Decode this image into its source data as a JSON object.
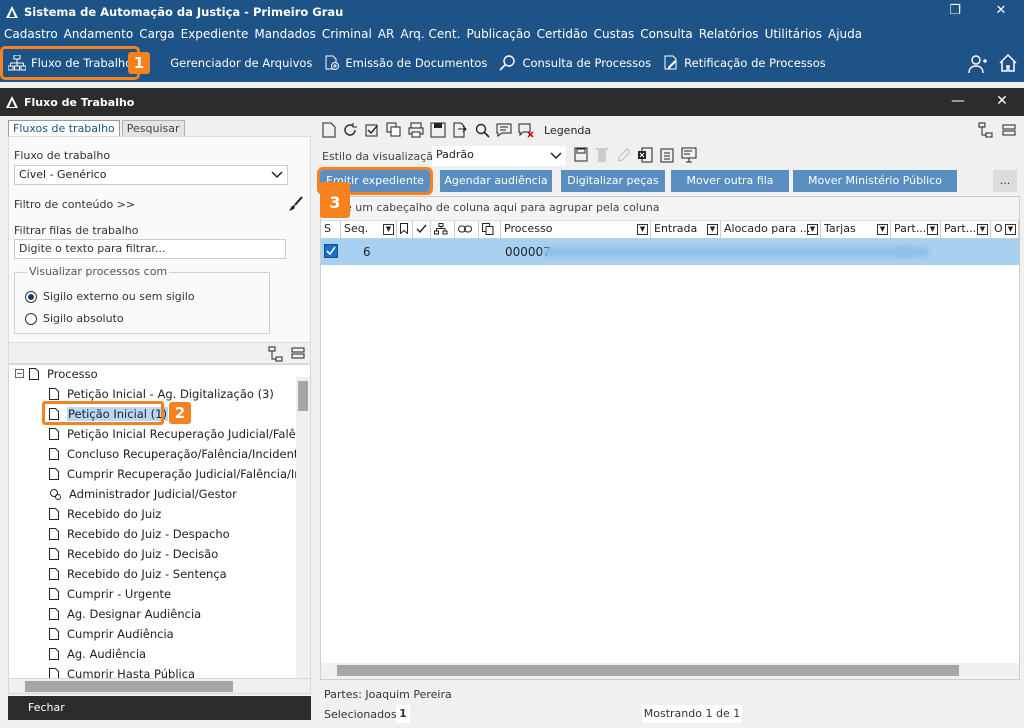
{
  "window": {
    "title": "Sistema de Automação da Justiça - Primeiro Grau"
  },
  "menu": [
    "Cadastro",
    "Andamento",
    "Carga",
    "Expediente",
    "Mandados",
    "Criminal",
    "AR",
    "Arq. Cent.",
    "Publicação",
    "Certidão",
    "Custas",
    "Consulta",
    "Relatórios",
    "Utilitários",
    "Ajuda"
  ],
  "toolbar": {
    "items": [
      "Fluxo de Trabalho",
      "Gerenciador de Arquivos",
      "Emissão de Documentos",
      "Consulta de Processos",
      "Retificação de Processos"
    ]
  },
  "badges": [
    "1",
    "2",
    "3"
  ],
  "panel": {
    "title": "Fluxo de Trabalho"
  },
  "left": {
    "tabs": [
      "Fluxos de trabalho",
      "Pesquisar"
    ],
    "fluxo_label": "Fluxo de trabalho",
    "fluxo_value": "Cível - Genérico",
    "filtro_conteudo": "Filtro de conteúdo >>",
    "filtrar_label": "Filtrar filas de trabalho",
    "filtrar_placeholder": "Digite o texto para filtrar...",
    "visualizar_label": "Visualizar processos com",
    "radio1": "Sigilo externo ou sem sigilo",
    "radio2": "Sigilo absoluto",
    "tree_root": "Processo",
    "tree_items": [
      "Petição Inicial - Ag. Digitalização (3)",
      "Petição Inicial (1)",
      "Petição Inicial Recuperação Judicial/Falênc",
      "Concluso Recuperação/Falência/Incidentes",
      "Cumprir Recuperação Judicial/Falência/Inc",
      "Administrador Judicial/Gestor",
      "Recebido do Juiz",
      "Recebido do Juiz - Despacho",
      "Recebido do Juiz - Decisão",
      "Recebido do Juiz - Sentença",
      "Cumprir - Urgente",
      "Ag. Designar Audiência",
      "Cumprir Audiência",
      "Ag. Audiência",
      "Cumprir Hasta Pública"
    ],
    "fechar": "Fechar"
  },
  "right": {
    "legenda": "Legenda",
    "estilo_label": "Estilo da visualização",
    "estilo_value": "Padrão",
    "buttons": [
      "Emitir expediente",
      "Agendar audiência",
      "Digitalizar peças",
      "Mover outra fila",
      "Mover Ministério Público",
      "..."
    ],
    "group_hint": "e um cabeçalho de coluna aqui para agrupar pela coluna",
    "columns": [
      "S",
      "Seq.",
      "Processo",
      "Entrada",
      "Alocado para ...",
      "Tarjas",
      "Part...",
      "Part...",
      "O"
    ],
    "row": {
      "seq": "6",
      "processo": "000007"
    },
    "partes": "Partes: Joaquim Pereira",
    "selecionados_label": "Selecionados",
    "selecionados_value": "1",
    "mostrando": "Mostrando 1 de 1"
  }
}
